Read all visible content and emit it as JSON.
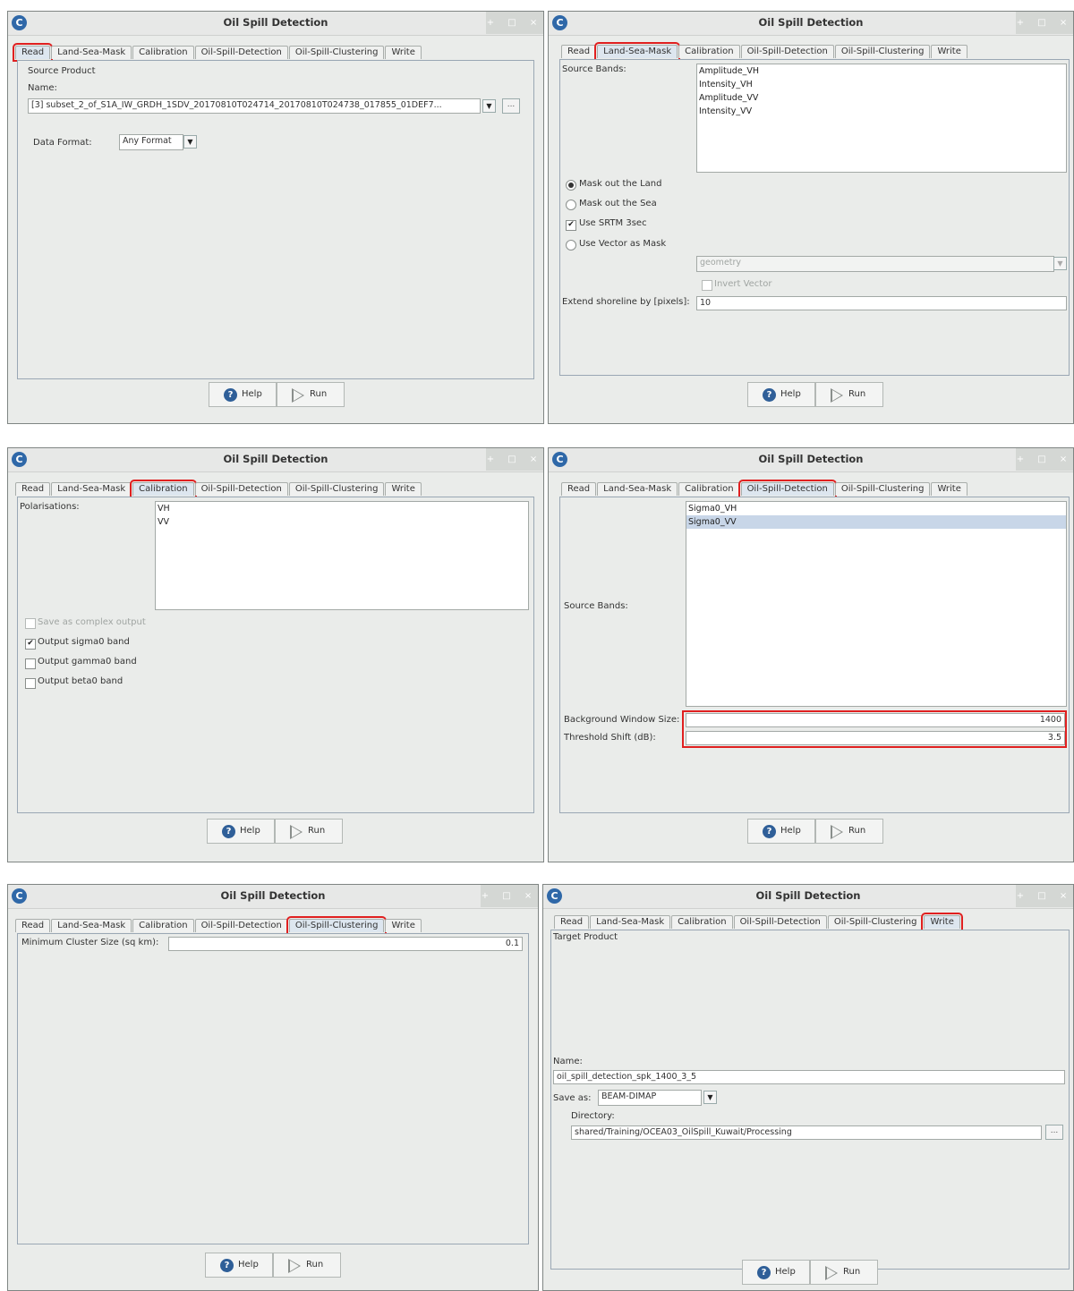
{
  "window": {
    "title": "Oil Spill Detection",
    "logo": "C",
    "controls": "+ □ ×"
  },
  "tabs": [
    "Read",
    "Land-Sea-Mask",
    "Calibration",
    "Oil-Spill-Detection",
    "Oil-Spill-Clustering",
    "Write"
  ],
  "buttons": {
    "help": "Help",
    "run": "Run",
    "help_icon": "?",
    "dropdown_arrow": "▼",
    "browse": "..."
  },
  "panel_read": {
    "group_label": "Source Product",
    "name_label": "Name:",
    "name_value": "[3] subset_2_of_S1A_IW_GRDH_1SDV_20170810T024714_20170810T024738_017855_01DEF7...",
    "format_label": "Data Format:",
    "format_value": "Any Format"
  },
  "panel_land_sea": {
    "source_bands_label": "Source Bands:",
    "bands": [
      "Amplitude_VH",
      "Intensity_VH",
      "Amplitude_VV",
      "Intensity_VV"
    ],
    "opt_mask_land": "Mask out the Land",
    "opt_mask_sea": "Mask out the Sea",
    "opt_srtm": "Use SRTM 3sec",
    "opt_vector": "Use Vector as Mask",
    "geometry_placeholder": "geometry",
    "invert_vector": "Invert Vector",
    "shoreline_label": "Extend shoreline by [pixels]:",
    "shoreline_value": "10"
  },
  "panel_calibration": {
    "polarisations_label": "Polarisations:",
    "polarisations": [
      "VH",
      "VV"
    ],
    "opt_complex": "Save as complex output",
    "opt_sigma0": "Output sigma0 band",
    "opt_gamma0": "Output gamma0 band",
    "opt_beta0": "Output beta0 band"
  },
  "panel_detection": {
    "source_bands_label": "Source Bands:",
    "bands": [
      "Sigma0_VH",
      "Sigma0_VV"
    ],
    "bg_window_label": "Background Window Size:",
    "bg_window_value": "1400",
    "threshold_label": "Threshold Shift (dB):",
    "threshold_value": "3.5"
  },
  "panel_clustering": {
    "min_cluster_label": "Minimum Cluster Size (sq km):",
    "min_cluster_value": "0.1"
  },
  "panel_write": {
    "group_label": "Target Product",
    "name_label": "Name:",
    "name_value": "oil_spill_detection_spk_1400_3_5",
    "save_as_label": "Save as:",
    "save_as_value": "BEAM-DIMAP",
    "directory_label": "Directory:",
    "directory_value": "shared/Training/OCEA03_OilSpill_Kuwait/Processing"
  }
}
